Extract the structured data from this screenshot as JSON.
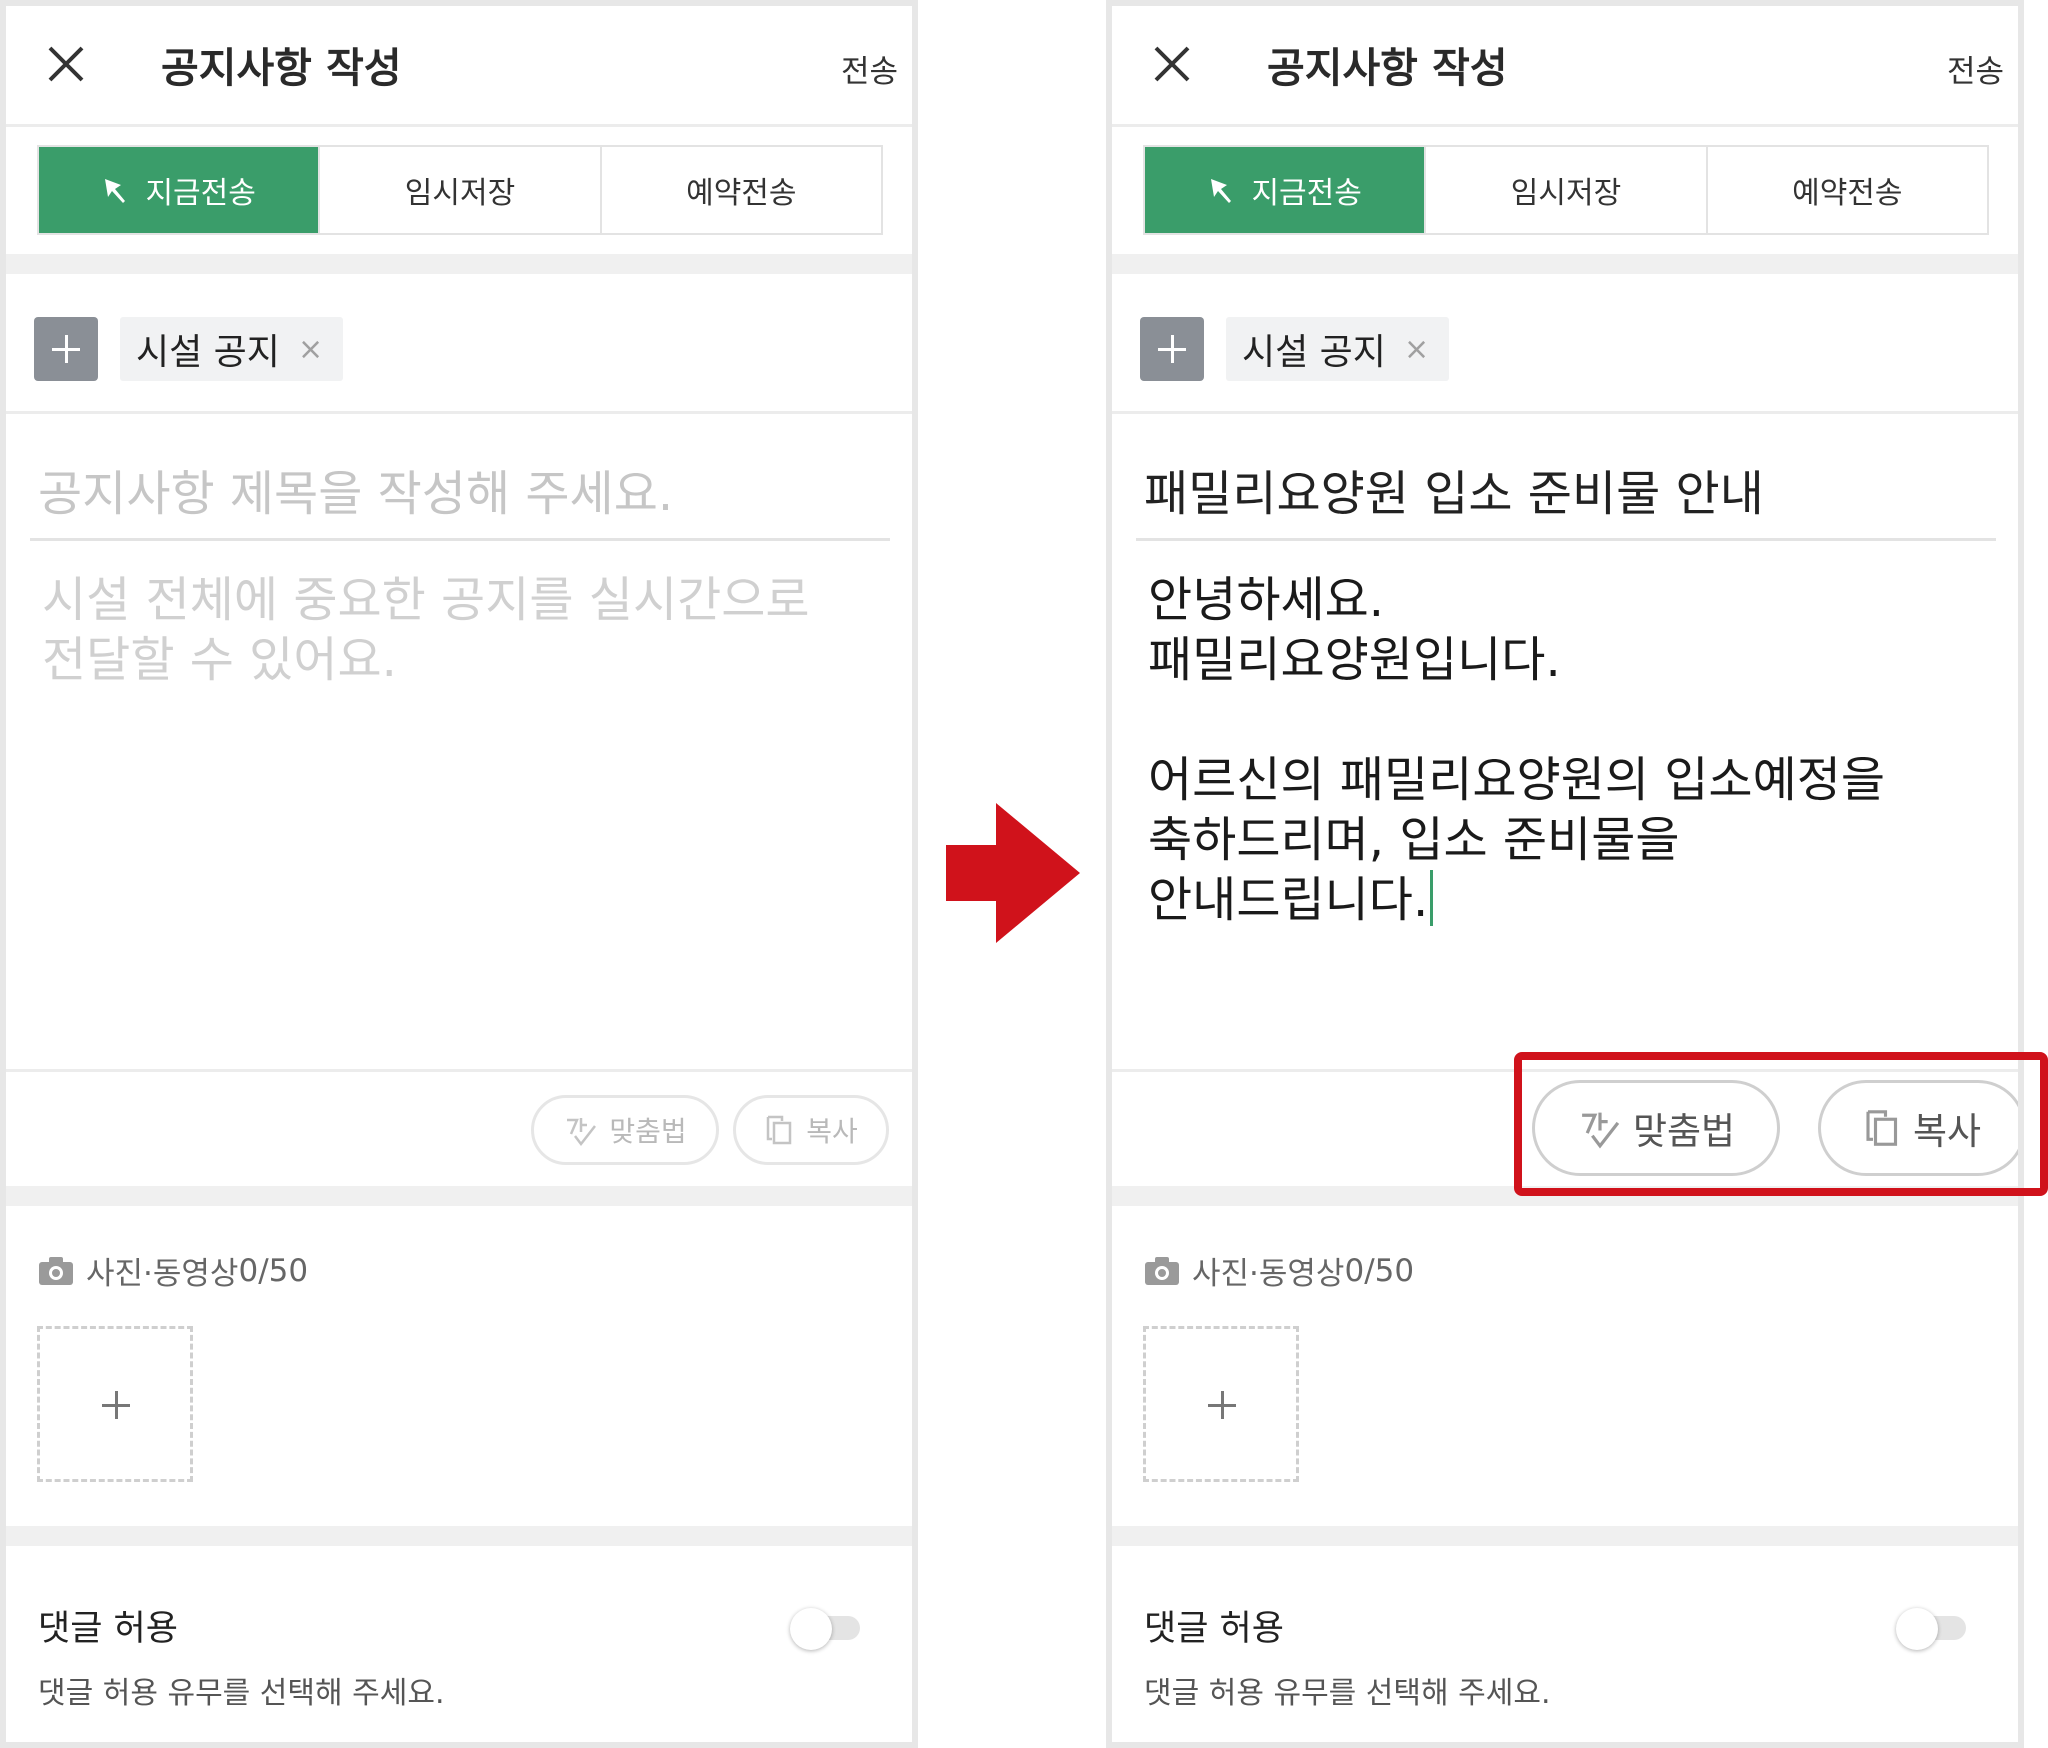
{
  "header": {
    "title": "공지사항 작성",
    "send_label": "전송"
  },
  "send_modes": [
    "지금전송",
    "임시저장",
    "예약전송"
  ],
  "tag": {
    "label": "시설 공지",
    "remove": "×"
  },
  "before": {
    "title_placeholder": "공지사항 제목을 작성해 주세요.",
    "body_placeholder": "시설 전체에 중요한 공지를 실시간으로\n전달할 수 있어요."
  },
  "after": {
    "title_value": "패밀리요양원 입소 준비물 안내",
    "body_value": "안녕하세요.\n패밀리요양원입니다.\n\n어르신의 패밀리요양원의 입소예정을\n축하드리며, 입소 준비물을\n안내드립니다."
  },
  "tools": {
    "spellcheck_label": "맞춤법",
    "copy_label": "복사"
  },
  "media": {
    "label": "사진·동영상",
    "count": "0/50"
  },
  "comments": {
    "title": "댓글 허용",
    "description": "댓글 허용 유무를 선택해 주세요.",
    "enabled": false
  },
  "colors": {
    "accent": "#3a9d6a",
    "highlight": "#d0121b",
    "arrow": "#d0121b"
  }
}
